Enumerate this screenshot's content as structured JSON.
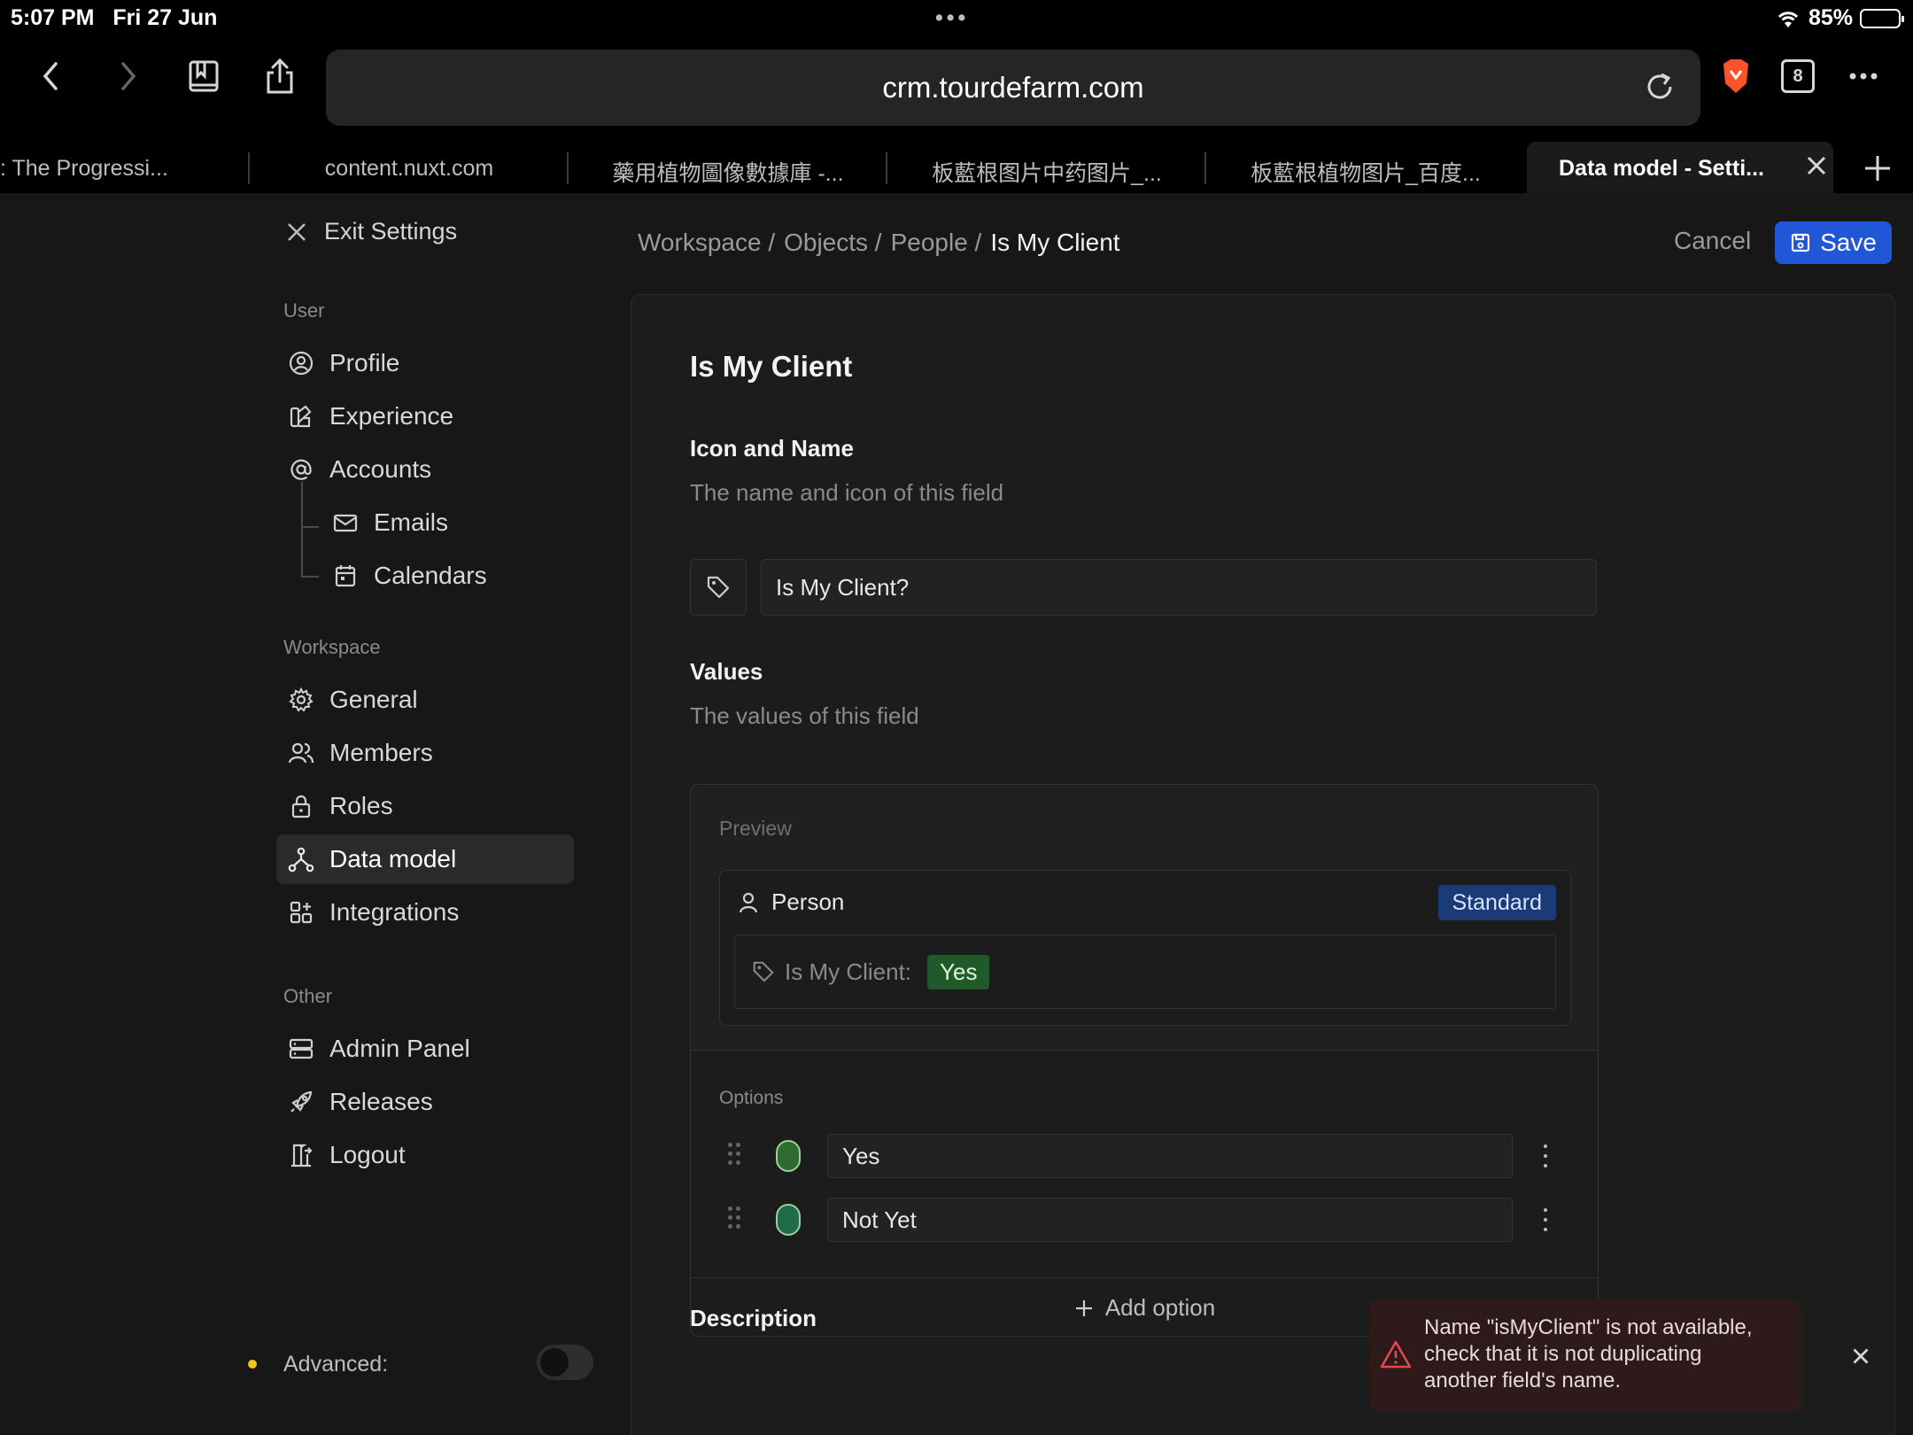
{
  "status_bar": {
    "time": "5:07 PM",
    "date": "Fri 27 Jun",
    "battery": "85%",
    "battery_level": 0.85
  },
  "browser": {
    "url": "crm.tourdefarm.com",
    "tab_count": "8",
    "tabs": [
      {
        "label": ": The Progressi..."
      },
      {
        "label": "content.nuxt.com"
      },
      {
        "label": "藥用植物圖像數據庫 -..."
      },
      {
        "label": "板藍根图片中药图片_..."
      },
      {
        "label": "板藍根植物图片_百度..."
      },
      {
        "label": "Data model - Setti..."
      }
    ]
  },
  "sidebar": {
    "exit_label": "Exit Settings",
    "user_section": "User",
    "workspace_section": "Workspace",
    "other_section": "Other",
    "items": {
      "profile": "Profile",
      "experience": "Experience",
      "accounts": "Accounts",
      "emails": "Emails",
      "calendars": "Calendars",
      "general": "General",
      "members": "Members",
      "roles": "Roles",
      "data_model": "Data model",
      "integrations": "Integrations",
      "admin_panel": "Admin Panel",
      "releases": "Releases",
      "logout": "Logout"
    },
    "advanced_label": "Advanced:"
  },
  "header": {
    "breadcrumb": [
      "Workspace /",
      "Objects /",
      "People /",
      "Is My Client"
    ],
    "cancel_label": "Cancel",
    "save_label": "Save"
  },
  "main": {
    "title": "Is My Client",
    "icon_name_title": "Icon and Name",
    "icon_name_desc": "The name and icon of this field",
    "field_name_value": "Is My Client?",
    "values_title": "Values",
    "values_desc": "The values of this field",
    "preview_label": "Preview",
    "preview_object": "Person",
    "preview_badge": "Standard",
    "preview_field_label": "Is My Client:",
    "preview_field_value": "Yes",
    "options_label": "Options",
    "options": [
      {
        "value": "Yes",
        "color": "#2f6b2f"
      },
      {
        "value": "Not Yet",
        "color": "#1f6b4a"
      }
    ],
    "add_option_label": "Add option",
    "description_title": "Description"
  },
  "toast": {
    "message": "Name \"isMyClient\" is not available, check that it is not duplicating another field's name."
  },
  "colors": {
    "accent": "#1f57d6",
    "error": "#e5484d",
    "advanced_dot": "#f5c518"
  }
}
